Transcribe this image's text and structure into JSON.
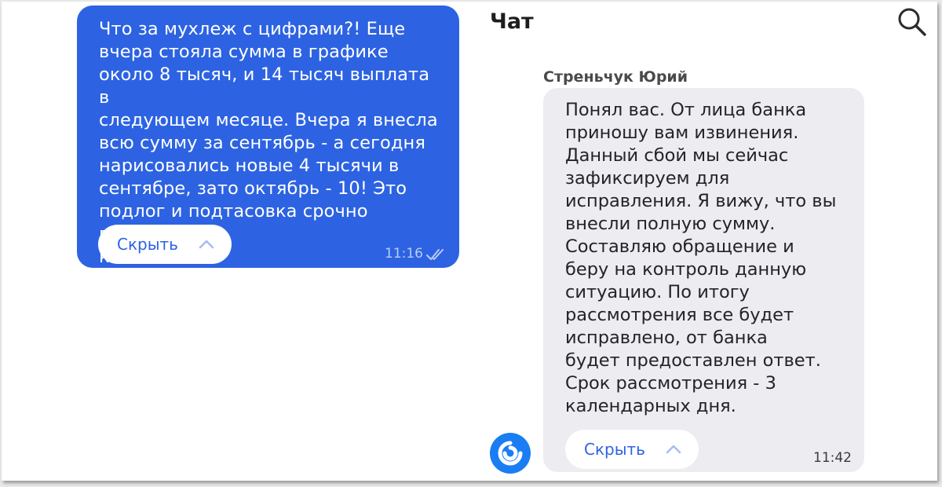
{
  "chat": {
    "title": "Чат"
  },
  "outgoing_message": {
    "text": "Что за мухлеж с цифрами?! Еще\nвчера стояла сумма в графике\nоколо 8 тысяч, и 14 тысяч выплата в\nследующем месяце. Вчера я внесла\nвсю сумму за сентябрь - а сегодня\nнарисовались новые 4 тысячи в\nсентябре, зато октябрь - 10! Это\nподлог и подтасовка срочно верните,\nкак было!!!!",
    "hide_label": "Скрыть",
    "time": "11:16",
    "status_icon": "double-check-icon"
  },
  "incoming_message": {
    "sender": "Стреньчук Юрий",
    "text": "Понял вас. От лица банка\nприношу вам извинения.\nДанный сбой мы сейчас\nзафиксируем для\nисправления. Я вижу, что вы\nвнесли полную сумму.\nСоставляю обращение и\nберу на контроль данную\nситуацию. По итогу\nрассмотрения все будет\nисправлено, от банка\nбудет предоставлен ответ.\nСрок рассмотрения - 3\nкалендарных дня.",
    "hide_label": "Скрыть",
    "time": "11:42"
  },
  "icons": {
    "search": "search-icon",
    "chevron": "chevron-up-icon",
    "avatar": "bank-logo-icon"
  },
  "colors": {
    "accent_blue": "#2d63e2",
    "incoming_bubble": "#ececf1",
    "avatar_blue": "#1b7df3"
  }
}
